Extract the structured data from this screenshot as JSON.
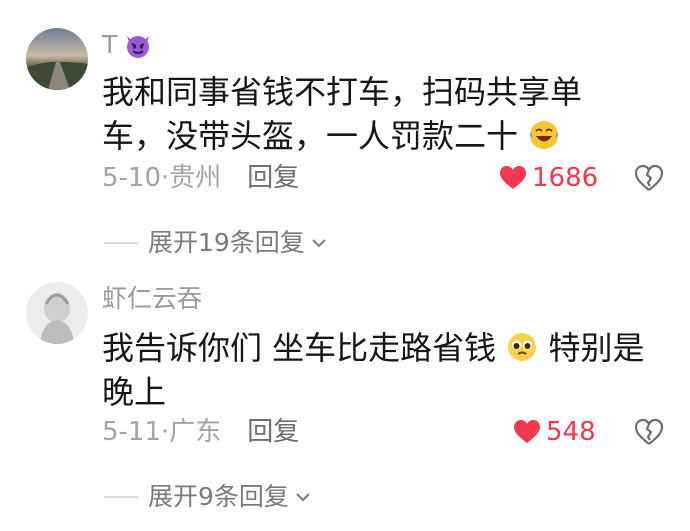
{
  "comments": [
    {
      "username": "T",
      "text_line1": "我和同事省钱不打车，扫码共享单",
      "text_line2": "车，没带头盔，一人罚款二十",
      "date": "5-10",
      "location": "贵州",
      "reply_label": "回复",
      "likes": "1686",
      "expand_label": "展开19条回复"
    },
    {
      "username": "虾仁云吞",
      "text_line1a": "我告诉你们 坐车比走路省钱",
      "text_line1b": "特别是",
      "text_line2": "晚上",
      "date": "5-11",
      "location": "广东",
      "reply_label": "回复",
      "likes": "548",
      "expand_label": "展开9条回复"
    }
  ],
  "colors": {
    "like": "#f0384f",
    "meta": "#a3a3a3",
    "text": "#161616"
  },
  "icons": [
    "devil-emoji-icon",
    "laugh-cry-emoji-icon",
    "pleading-emoji-icon",
    "heart-icon",
    "broken-heart-icon",
    "chevron-down-icon"
  ]
}
